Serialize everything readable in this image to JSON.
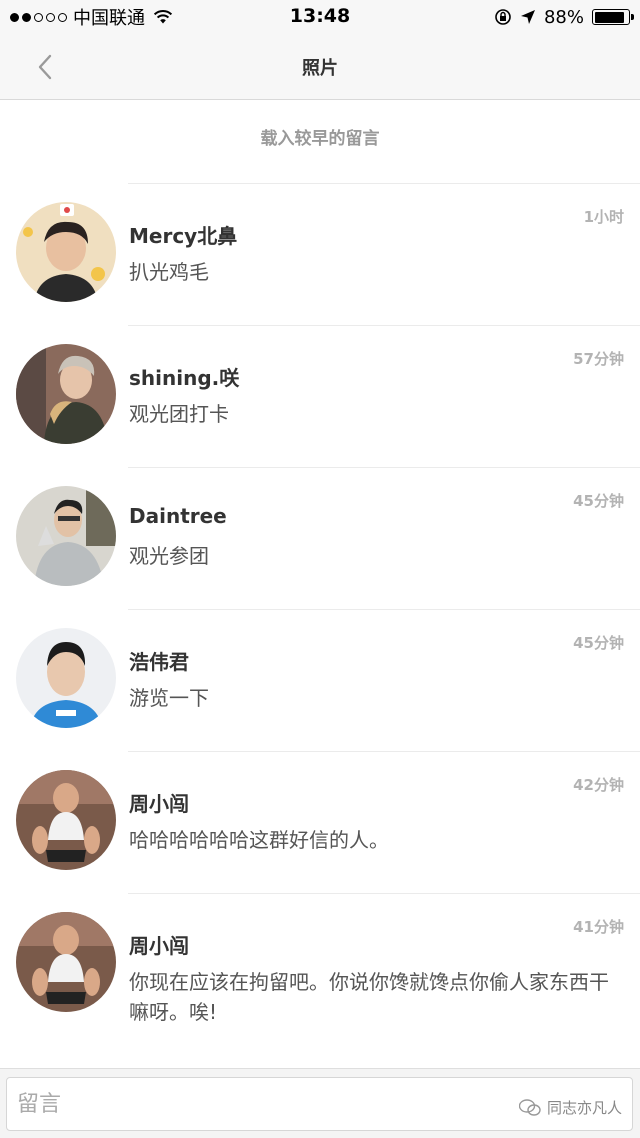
{
  "status_bar": {
    "carrier": "中国联通",
    "time": "13:48",
    "battery": "88%",
    "battery_level": 0.88,
    "signal_bars_filled": 2,
    "signal_bars_total": 5
  },
  "nav": {
    "title": "照片",
    "back_icon": "chevron-left-icon"
  },
  "load_earlier_label": "载入较早的留言",
  "comments": [
    {
      "name": "Mercy北鼻",
      "time": "1小时",
      "text": "扒光鸡毛"
    },
    {
      "name": "shining.咲",
      "time": "57分钟",
      "text": "观光团打卡"
    },
    {
      "name": "Daintree",
      "time": "45分钟",
      "text": "观光参团"
    },
    {
      "name": "浩伟君",
      "time": "45分钟",
      "text": "游览一下"
    },
    {
      "name": "周小闯",
      "time": "42分钟",
      "text": "哈哈哈哈哈哈这群好信的人。"
    },
    {
      "name": "周小闯",
      "time": "41分钟",
      "text": "你现在应该在拘留吧。你说你馋就馋点你偷人家东西干嘛呀。唉!"
    }
  ],
  "input": {
    "placeholder": "留言"
  },
  "watermark": {
    "text": "同志亦凡人"
  },
  "colors": {
    "bar_bg": "#f7f7f7",
    "name": "#333333",
    "text": "#555555",
    "time": "#b3b3b3",
    "divider": "#ebebeb"
  }
}
